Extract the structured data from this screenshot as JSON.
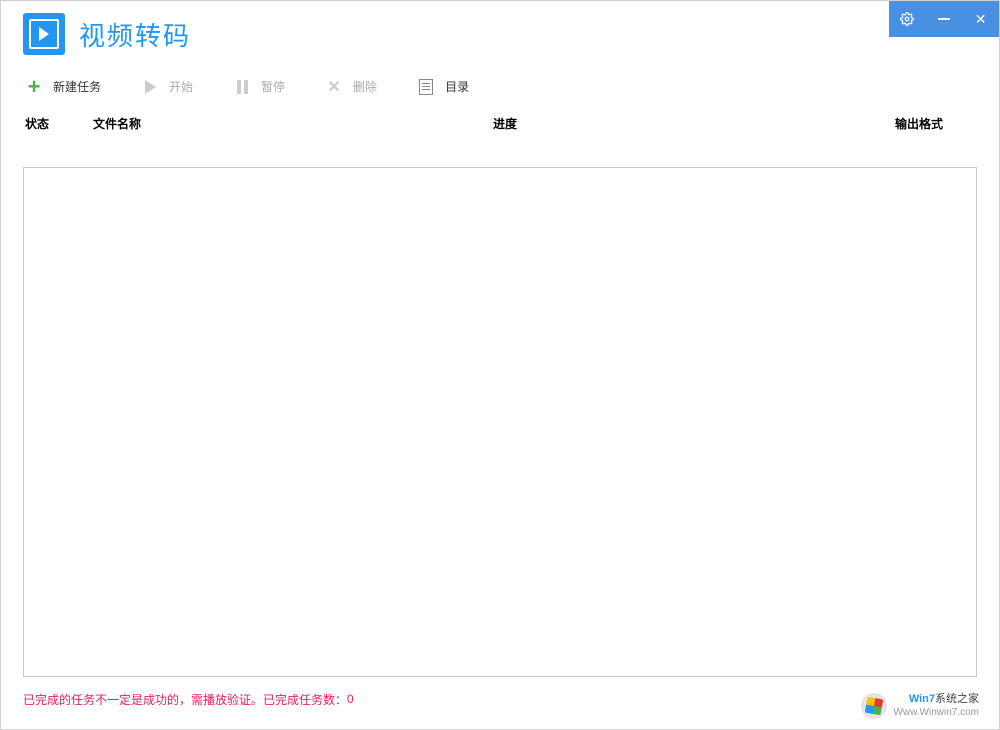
{
  "app": {
    "title": "视频转码"
  },
  "toolbar": {
    "new_task": "新建任务",
    "start": "开始",
    "pause": "暂停",
    "delete": "删除",
    "directory": "目录"
  },
  "columns": {
    "status": "状态",
    "filename": "文件名称",
    "progress": "进度",
    "output_format": "输出格式"
  },
  "status": {
    "message": "已完成的任务不一定是成功的，需播放验证。已完成任务数：",
    "completed_count": "0"
  },
  "watermark": {
    "brand": "Win7",
    "suffix": "系统之家",
    "url": "Www.Winwin7.com"
  },
  "rows": []
}
